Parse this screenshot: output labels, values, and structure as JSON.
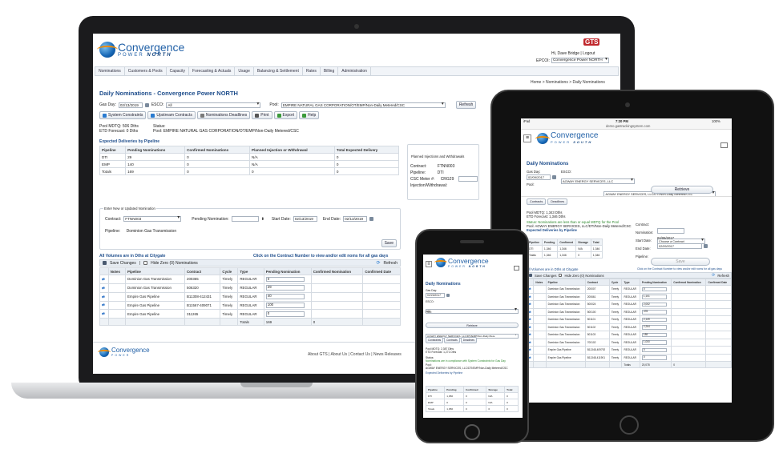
{
  "brand": {
    "name": "Convergence",
    "sub_laptop": "POWER",
    "sub_laptop_region": "NORTH",
    "sub_tablet_region": "SOUTH",
    "gts": "GTS"
  },
  "laptop": {
    "user_line": "Hi, Dave Bridge | Logout",
    "epco_label": "EPCOI:",
    "epco_value": "Convergence Power NORTH",
    "nav": [
      "Nominations",
      "Customers & Pools",
      "Capacity",
      "Forecasting & Actuals",
      "Usage",
      "Balancing & Settlement",
      "Rates",
      "Billing",
      "Administration"
    ],
    "breadcrumb": "Home > Nominations > Daily Nominations",
    "page_title": "Daily Nominations - Convergence Power NORTH",
    "gas_day_label": "Gas Day:",
    "gas_day_value": "02/13/2019",
    "esco_label": "ESCO:",
    "esco_value": "All",
    "pool_label": "Pool:",
    "pool_value": "EMPIRE NATURAL GAS CORPORATION/OT/EMP/Non-Daily Metered/CSC",
    "refresh_top": "Refresh",
    "toolbar": [
      "System Constraints",
      "Upstream Contracts",
      "Nominations Deadlines",
      "Print",
      "Export",
      "Help"
    ],
    "pool_mdtq": "Pool MDTQ:  506 Dths",
    "etd_forecast": "ETD Forecast: 0 Dths",
    "status_label": "Status:",
    "pool_line_label": "Pool:",
    "pool_line_value": "EMPIRE NATURAL GAS CORPORATION/OT/EMP/Non-Daily Metered/CSC",
    "exp_title": "Expected Deliveries by Pipeline",
    "exp_headers": [
      "Pipeline",
      "Pending Nominations",
      "Confirmed Nominations",
      "Planned Injection or Withdrawal",
      "Total Expected Delivery"
    ],
    "exp_rows": [
      [
        "DTI",
        "29",
        "0",
        "N/A",
        "0"
      ],
      [
        "EMP",
        "140",
        "0",
        "N/A",
        "0"
      ],
      [
        "Totals",
        "169",
        "0",
        "0",
        "0"
      ]
    ],
    "planned_title": "Planned Injections and Withdrawals",
    "planned_contract_label": "Contract:",
    "planned_contract_value": "FTNN003",
    "planned_pipeline_label": "Pipeline:",
    "planned_pipeline_value": "DTI",
    "planned_csc_label": "CSC Meter #:",
    "planned_csc_value": "CRG29",
    "planned_inj_label": "Injection/Withdrawal:",
    "enter_title": "Enter New or Updated Nomination",
    "contract_label": "Contract:",
    "contract_value": "FTNN003",
    "pending_label": "Pending Nomination:",
    "start_label": "Start Date:",
    "start_value": "02/13/2019",
    "end_label": "End Date:",
    "end_value": "02/13/2019",
    "pipeline_label": "Pipeline:",
    "pipeline_value": "Dominion Gas Transmission",
    "save_label": "Save",
    "volumes_note": "All Volumes are in Dths at Citygate",
    "click_note": "Click on the Contract Number to view and/or edit noms for all gas days",
    "save_changes": "Save Changes",
    "hide_zero": "Hide Zero (0) Nominations",
    "refresh_grid": "Refresh",
    "grid_headers": [
      "",
      "Notes",
      "Pipeline",
      "Contract",
      "Cycle",
      "Type",
      "Pending Nomination",
      "Confirmed Nomination",
      "Confirmed Date"
    ],
    "grid_rows": [
      [
        "Dominion Gas Transmission",
        "200365",
        "Timely",
        "REGULAR",
        "0"
      ],
      [
        "Dominion Gas Transmission",
        "506320",
        "Timely",
        "REGULAR",
        "29"
      ],
      [
        "Empire Gas Pipeline",
        "B11308-412431",
        "Timely",
        "REGULAR",
        "40"
      ],
      [
        "Empire Gas Pipeline",
        "B11567-409071",
        "Timely",
        "REGULAR",
        "100"
      ],
      [
        "Empire Gas Pipeline",
        "311265",
        "Timely",
        "REGULAR",
        "0"
      ]
    ],
    "totals_label": "Totals",
    "totals_pending": "169",
    "totals_confirmed": "0",
    "footer_links": "About GTS | About Us | Contact Us | News Releases"
  },
  "tablet": {
    "status_left": "iPad",
    "time": "7:20 PM",
    "battery": "100%",
    "url": "demo.gastrackingsystem.com",
    "title": "Daily Nominations",
    "gas_day_label": "Gas Day:",
    "gas_day_value": "02/09/2017",
    "esco_label": "ESCO:",
    "esco_value": "AGWAY ENERGY SERVICES, LLC",
    "pool_label": "Pool:",
    "pool_value": "AGWAY ENERGY SERVICES, LLC/DTI/Non-Daily Metered/CSC",
    "retrieve": "Retrieve",
    "tabs": [
      "Contracts",
      "Deadlines"
    ],
    "mdtq": "Pool MDTQ:  1,343 Dths",
    "etd": "ETD Forecast: 1,346 Dths",
    "status_text": "Nominations are less than or equal MDTQ for the Pool",
    "pool_text": "AGWAY ENERGY SERVICES, LLC/DTI/Non-Daily Metered/CSC",
    "exp_title": "Expected Deliveries by Pipeline",
    "exp_headers": [
      "Pipeline",
      "Pending",
      "Confirmed",
      "Storage",
      "Total"
    ],
    "exp_rows": [
      [
        "DTI",
        "1,346",
        "1,346",
        "N/A",
        "1,346"
      ],
      [
        "Totals",
        "1,346",
        "1,346",
        "0",
        "1,346"
      ]
    ],
    "contract_label": "Contract:",
    "contract_value": "Choose a Contract",
    "nomination_label": "Nomination:",
    "start_label": "Start Date:",
    "start_value": "02/09/2017",
    "end_label": "End Date:",
    "end_value": "02/09/2017",
    "pipeline_label": "Pipeline:",
    "save": "Save",
    "volumes_note": "All Volumes are in Dths at Citygate",
    "click_note": "Click on the Contract Number to view and/or edit noms for all gas days",
    "save_changes": "Save Changes",
    "hide_zero": "Hide Zero (0) Nominations",
    "refresh": "Refresh",
    "grid_headers": [
      "",
      "Notes",
      "Pipeline",
      "Contract",
      "Cycle",
      "Type",
      "Pending Nomination",
      "Confirmed Nomination",
      "Confirmed Date"
    ],
    "grid_rows": [
      [
        "Dominion Gas Transmission",
        "200007",
        "Timely",
        "REGULAR",
        "0"
      ],
      [
        "Dominion Gas Transmission",
        "200661",
        "Timely",
        "REGULAR",
        "1,101"
      ],
      [
        "Dominion Gas Transmission",
        "500024",
        "Timely",
        "REGULAR",
        "2,002"
      ],
      [
        "Dominion Gas Transmission",
        "500100",
        "Timely",
        "REGULAR",
        "478"
      ],
      [
        "Dominion Gas Transmission",
        "501101",
        "Timely",
        "REGULAR",
        "2,149"
      ],
      [
        "Dominion Gas Transmission",
        "501102",
        "Timely",
        "REGULAR",
        "2,264"
      ],
      [
        "Dominion Gas Transmission",
        "501103",
        "Timely",
        "REGULAR",
        "188"
      ],
      [
        "Dominion Gas Transmission",
        "700102",
        "Timely",
        "REGULAR",
        "1,000"
      ],
      [
        "Empire Gas Pipeline",
        "B11348-409792",
        "Timely",
        "REGULAR",
        "0"
      ],
      [
        "Empire Gas Pipeline",
        "B11348-411901",
        "Timely",
        "REGULAR",
        "0"
      ]
    ],
    "totals_label": "Totals",
    "totals_value": "20,078",
    "totals_confirmed": "0"
  },
  "phone": {
    "title": "Daily Nominations",
    "gas_day_label": "Gas Day:",
    "gas_day_value": "02/23/2017",
    "esco_label": "ESCO:",
    "esco_value": "All",
    "pool_label": "Pool:",
    "pool_value": "AGWAY ENERGY SERVICES, LLC/DTI/EMP/Non-Daily Mete",
    "retrieve": "Retrieve",
    "tabs": [
      "Constraints",
      "Contracts",
      "Deadlines"
    ],
    "mdtq": "Pool MDTQ:    2,387 Dths",
    "etd": "ETD Forecast:   1,271 Dths",
    "status_label": "Status:",
    "status_text": "Nominations are in compliance with System Constraints for Gas Day",
    "pool_label2": "Pool:",
    "pool_text": "AGWAY ENERGY SERVICES, LLC/DTI/EMP/Non-Daily Metered/CSC",
    "exp_title": "Expected Deliveries by Pipeline",
    "exp_headers": [
      "Pipeline",
      "Pending",
      "Confirmed",
      "Storage",
      "Total"
    ],
    "exp_rows": [
      [
        "DTI",
        "1,050",
        "0",
        "N/A",
        "0"
      ],
      [
        "EMP",
        "0",
        "0",
        "N/A",
        "0"
      ],
      [
        "Totals",
        "1,050",
        "0",
        "0",
        "0"
      ]
    ]
  },
  "colors": {
    "accent": "#1f5fa6",
    "brand_orange": "#f08a00",
    "gts_red": "#c0282d"
  }
}
